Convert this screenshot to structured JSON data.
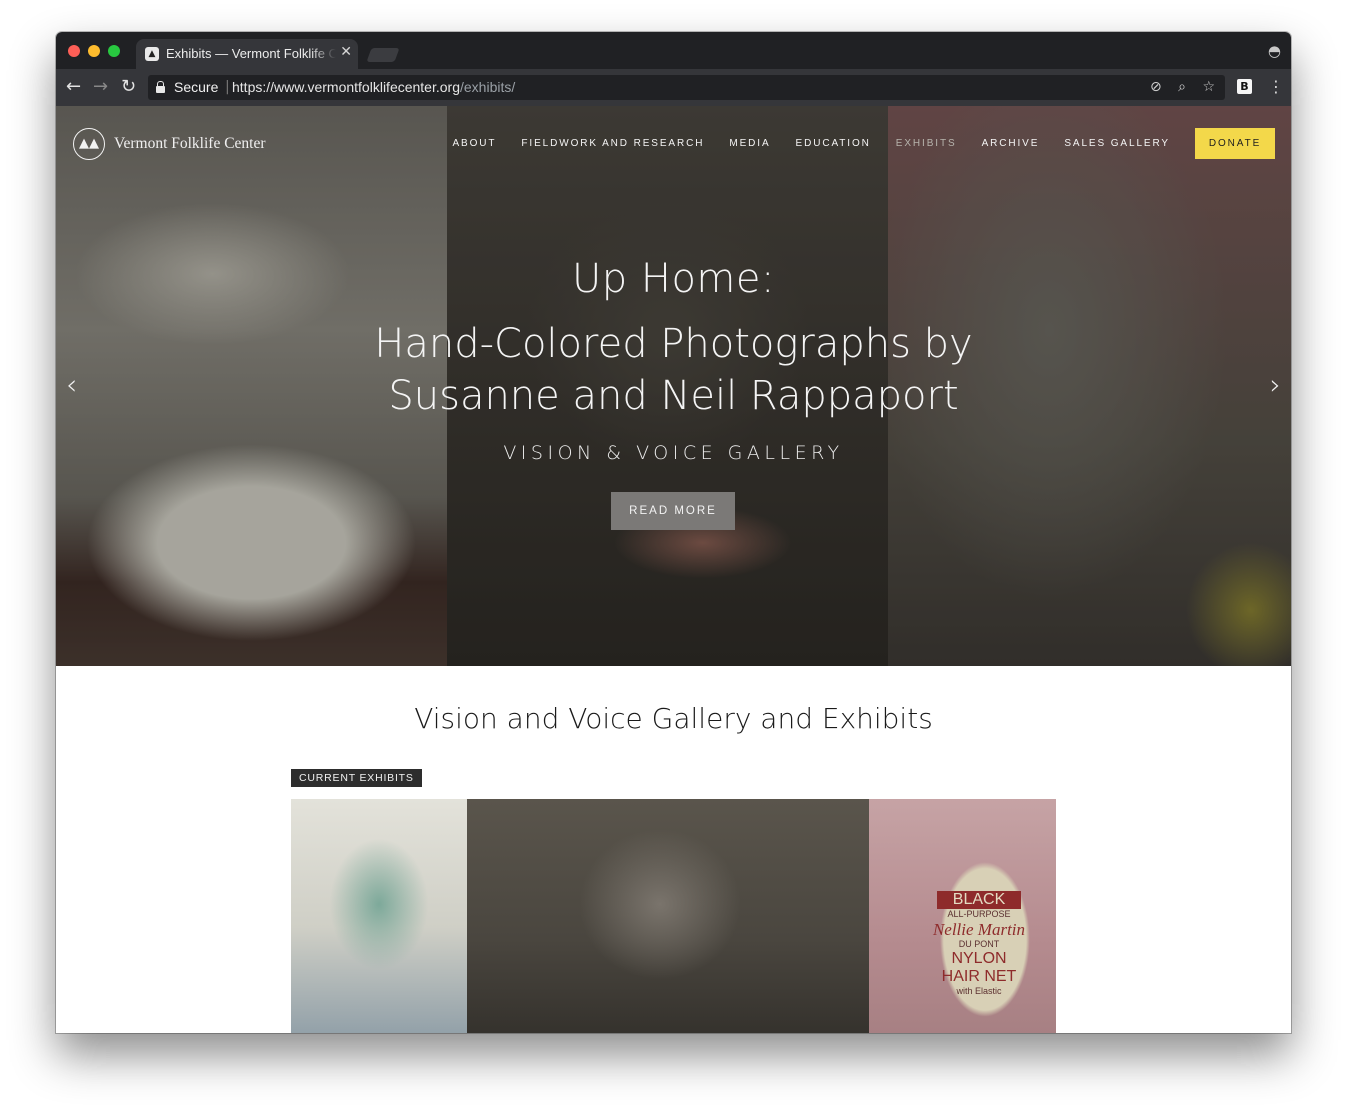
{
  "browser": {
    "tab_title": "Exhibits — Vermont Folklife Center",
    "tab_close": "✕",
    "secure_label": "Secure",
    "url_base": "https://www.vermontfolklifecenter.org",
    "url_path": "/exhibits/",
    "extension_label": "B"
  },
  "site": {
    "logo_text": "Vermont Folklife Center",
    "nav": [
      {
        "label": "ABOUT",
        "active": false
      },
      {
        "label": "FIELDWORK AND RESEARCH",
        "active": false
      },
      {
        "label": "MEDIA",
        "active": false
      },
      {
        "label": "EDUCATION",
        "active": false
      },
      {
        "label": "EXHIBITS",
        "active": true
      },
      {
        "label": "ARCHIVE",
        "active": false
      },
      {
        "label": "SALES GALLERY",
        "active": false
      }
    ],
    "donate_label": "DONATE",
    "accent_color": "#f3d84a"
  },
  "hero": {
    "title_line1": "Up Home:",
    "title_line2": "Hand-Colored Photographs by",
    "title_line3": "Susanne and Neil Rappaport",
    "subtitle": "VISION & VOICE GALLERY",
    "button_label": "READ MORE",
    "prev_arrow": "‹",
    "next_arrow": "›"
  },
  "content": {
    "heading": "Vision and Voice Gallery and Exhibits",
    "tag": "CURRENT EXHIBITS",
    "image_label": {
      "black": "BLACK",
      "purpose": "ALL-PURPOSE",
      "name": "Nellie Martin",
      "brand": "DU PONT",
      "nylon": "NYLON",
      "hairnet": "HAIR NET",
      "elastic": "with Elastic"
    }
  },
  "icons": [
    "back-arrow-icon",
    "forward-arrow-icon",
    "reload-icon",
    "lock-icon",
    "zoom-icon",
    "star-icon",
    "menu-dots-icon",
    "incognito-icon"
  ]
}
